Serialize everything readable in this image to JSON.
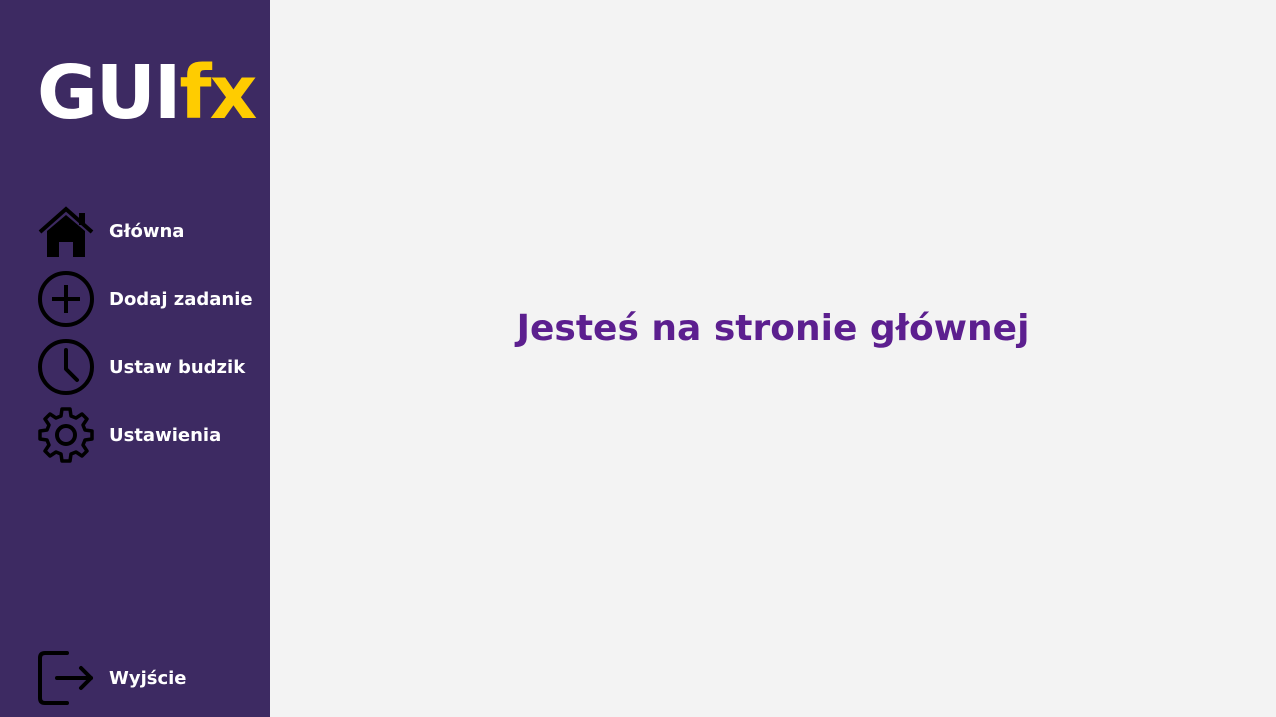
{
  "sidebar": {
    "logo": {
      "part1": "GUI",
      "part2": "fx"
    },
    "items": [
      {
        "label": "Główna",
        "icon": "home-icon"
      },
      {
        "label": "Dodaj zadanie",
        "icon": "add-circle-icon"
      },
      {
        "label": "Ustaw budzik",
        "icon": "clock-icon"
      },
      {
        "label": "Ustawienia",
        "icon": "gear-icon"
      }
    ],
    "exit": {
      "label": "Wyjście",
      "icon": "logout-icon"
    }
  },
  "main": {
    "heading": "Jesteś na stronie głównej"
  },
  "colors": {
    "sidebar_bg": "#3d2a62",
    "main_bg": "#f3f3f3",
    "logo_accent": "#ffcc00",
    "heading": "#5c1f8f"
  }
}
